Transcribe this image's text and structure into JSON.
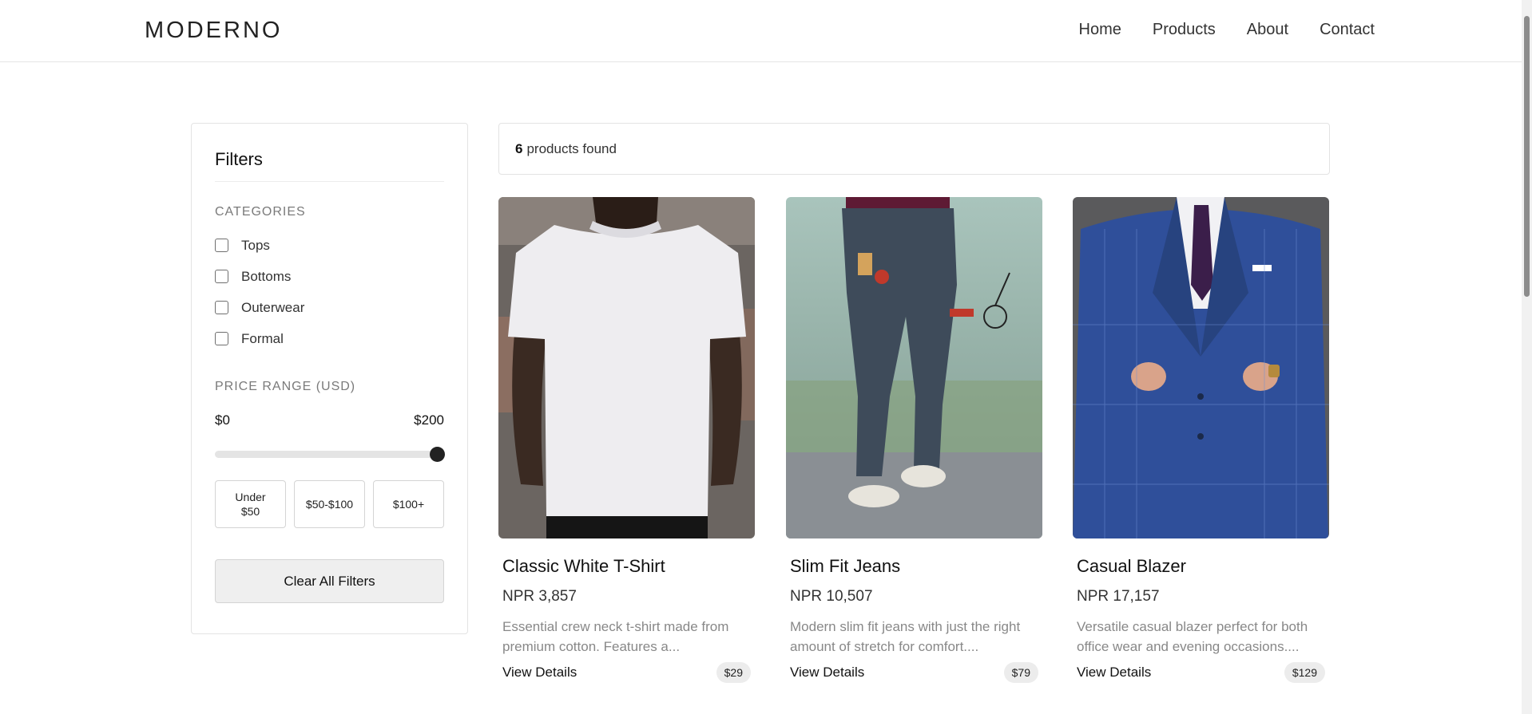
{
  "header": {
    "logo": "MODERNO",
    "nav": [
      "Home",
      "Products",
      "About",
      "Contact"
    ]
  },
  "sidebar": {
    "title": "Filters",
    "categories_label": "CATEGORIES",
    "categories": [
      "Tops",
      "Bottoms",
      "Outerwear",
      "Formal"
    ],
    "price_label": "PRICE RANGE (USD)",
    "price_min": "$0",
    "price_max": "$200",
    "slider_value_fraction": 1.0,
    "price_buttons": [
      "Under $50",
      "$50-$100",
      "$100+"
    ],
    "clear_label": "Clear All Filters"
  },
  "results": {
    "count": "6",
    "suffix": "products found"
  },
  "products": [
    {
      "title": "Classic White T-Shirt",
      "price": "NPR 3,857",
      "description": "Essential crew neck t-shirt made from premium cotton. Features a...",
      "link": "View Details",
      "tag": "$29"
    },
    {
      "title": "Slim Fit Jeans",
      "price": "NPR 10,507",
      "description": "Modern slim fit jeans with just the right amount of stretch for comfort....",
      "link": "View Details",
      "tag": "$79"
    },
    {
      "title": "Casual Blazer",
      "price": "NPR 17,157",
      "description": "Versatile casual blazer perfect for both office wear and evening occasions....",
      "link": "View Details",
      "tag": "$129"
    }
  ],
  "colors": {
    "accent": "#222222",
    "muted": "#888888",
    "border": "#e3e3e3"
  }
}
